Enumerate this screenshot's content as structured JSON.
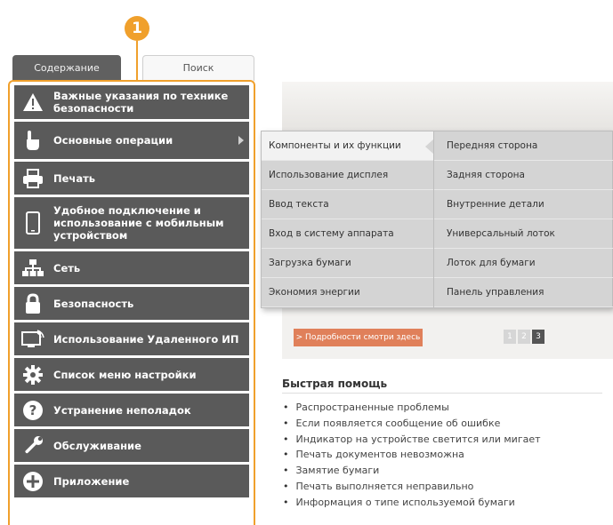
{
  "callout": "1",
  "tabs": {
    "contents": "Содержание",
    "search": "Поиск"
  },
  "menu": [
    {
      "label": "Важные указания по технике безопасности",
      "icon": "warning-icon"
    },
    {
      "label": "Основные операции",
      "icon": "hand-pointer-icon"
    },
    {
      "label": "Печать",
      "icon": "printer-icon"
    },
    {
      "label": "Удобное подключение и использование с мобильным устройством",
      "icon": "mobile-device-icon"
    },
    {
      "label": "Сеть",
      "icon": "network-icon"
    },
    {
      "label": "Безопасность",
      "icon": "lock-icon"
    },
    {
      "label": "Использование Удаленного ИП",
      "icon": "remote-ui-icon"
    },
    {
      "label": "Список меню настройки",
      "icon": "gear-icon"
    },
    {
      "label": "Устранение неполадок",
      "icon": "question-icon"
    },
    {
      "label": "Обслуживание",
      "icon": "wrench-icon"
    },
    {
      "label": "Приложение",
      "icon": "plus-icon"
    }
  ],
  "submenu": {
    "left": [
      "Компоненты и их функции",
      "Использование дисплея",
      "Ввод текста",
      "Вход в систему аппарата",
      "Загрузка бумаги",
      "Экономия энергии"
    ],
    "right": [
      "Передняя сторона",
      "Задняя сторона",
      "Внутренние детали",
      "Универсальный лоток",
      "Лоток для бумаги",
      "Панель управления"
    ]
  },
  "details_button": "> Подробности смотри здесь",
  "pager": [
    "1",
    "2",
    "3"
  ],
  "quick_help": {
    "title": "Быстрая помощь",
    "items": [
      "Распространенные проблемы",
      "Если появляется сообщение об ошибке",
      "Индикатор на устройстве светится или мигает",
      "Печать документов невозможна",
      "Замятие бумаги",
      "Печать выполняется неправильно",
      "Информация о типе используемой бумаги"
    ]
  },
  "colors": {
    "accent": "#f0a02c",
    "menu_bg": "#5a5a5a",
    "button": "#e0805a"
  }
}
